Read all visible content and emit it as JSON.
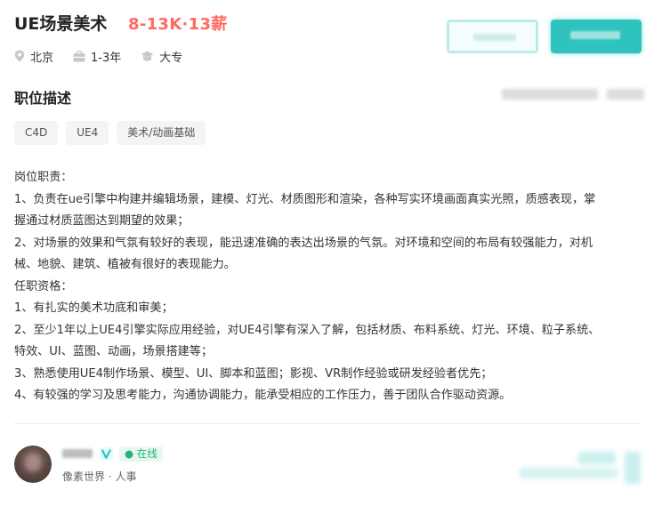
{
  "job": {
    "title": "UE场景美术",
    "salary": "8-13K·13薪",
    "location": "北京",
    "experience": "1-3年",
    "education": "大专"
  },
  "actions": {
    "interest_label": "",
    "chat_label": ""
  },
  "description": {
    "section_title": "职位描述",
    "tags": [
      "C4D",
      "UE4",
      "美术/动画基础"
    ],
    "lines": [
      "岗位职责：",
      "1、负责在ue引擎中构建并编辑场景，建模、灯光、材质图形和渲染，各种写实环境画面真实光照，质感表现，掌",
      "握通过材质蓝图达到期望的效果；",
      "2、对场景的效果和气氛有较好的表现，能迅速准确的表达出场景的气氛。对环境和空间的布局有较强能力，对机",
      "械、地貌、建筑、植被有很好的表现能力。",
      "任职资格：",
      "1、有扎实的美术功底和审美；",
      "2、至少1年以上UE4引擎实际应用经验，对UE4引擎有深入了解，包括材质、布料系统、灯光、环境、粒子系统、",
      "特效、UI、蓝图、动画，场景搭建等；",
      "3、熟悉使用UE4制作场景、模型、UI、脚本和蓝图；影视、VR制作经验或研发经验者优先；",
      "4、有较强的学习及思考能力，沟通协调能力，能承受相应的工作压力，善于团队合作驱动资源。"
    ]
  },
  "recruiter": {
    "status": "在线",
    "company_role": "像素世界 · 人事"
  },
  "colors": {
    "accent": "#00bebd",
    "salary": "#ff6a5f",
    "online": "#21b474"
  },
  "icons": {
    "location": "location-pin-icon",
    "experience": "briefcase-icon",
    "education": "graduation-cap-icon",
    "verified": "verified-v-icon"
  }
}
